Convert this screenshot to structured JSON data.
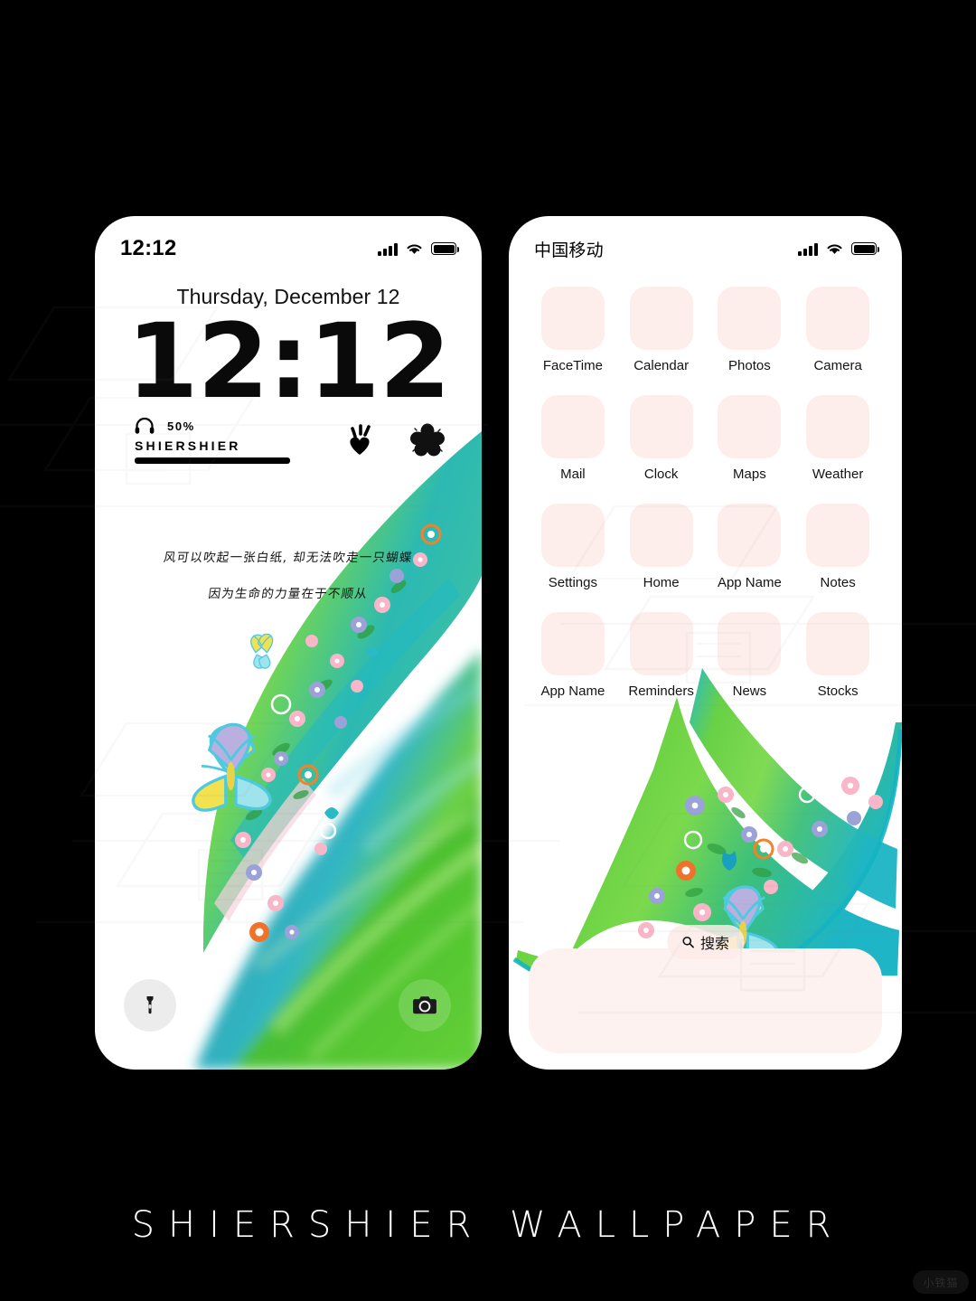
{
  "footer": {
    "title": "SHIERSHIER WALLPAPER"
  },
  "corner_watermark": {
    "label": "小铁猫"
  },
  "lock_screen": {
    "status": {
      "time": "12:12",
      "signal_icon": "signal-bars-icon",
      "wifi_icon": "wifi-icon",
      "battery_icon": "battery-icon"
    },
    "date": "Thursday, December 12",
    "time": "12:12",
    "audio_widget": {
      "headphone_icon": "headphones-icon",
      "percent": "50%",
      "device_name": "SHIERSHIER",
      "level": 100
    },
    "glyphs": [
      {
        "name": "heart-sparkle-icon"
      },
      {
        "name": "flower-icon"
      }
    ],
    "quote": {
      "line1": "风可以吹起一张白纸, 却无法吹走一只蝴蝶",
      "line2": "因为生命的力量在于不顺从"
    },
    "flashlight_icon": "flashlight-icon",
    "camera_icon": "camera-icon"
  },
  "home_screen": {
    "status": {
      "carrier": "中国移动",
      "signal_icon": "signal-bars-icon",
      "wifi_icon": "wifi-icon",
      "battery_icon": "battery-icon"
    },
    "apps": [
      {
        "label": "FaceTime"
      },
      {
        "label": "Calendar"
      },
      {
        "label": "Photos"
      },
      {
        "label": "Camera"
      },
      {
        "label": "Mail"
      },
      {
        "label": "Clock"
      },
      {
        "label": "Maps"
      },
      {
        "label": "Weather"
      },
      {
        "label": "Settings"
      },
      {
        "label": "Home"
      },
      {
        "label": "App Name"
      },
      {
        "label": "Notes"
      },
      {
        "label": "App Name"
      },
      {
        "label": "Reminders"
      },
      {
        "label": "News"
      },
      {
        "label": "Stocks"
      }
    ],
    "search": {
      "icon": "search-icon",
      "label": "搜索"
    }
  },
  "colors": {
    "background": "#000000",
    "phone_body": "#ffffff",
    "app_icon": "#fdeeeb",
    "dock": "#fdf2f0",
    "grass_green": "#5ec93a",
    "teal": "#16b7ad",
    "accent_pink": "#f6b0c4",
    "accent_orange": "#f57d2a",
    "butterfly_yellow": "#f5e04a"
  }
}
